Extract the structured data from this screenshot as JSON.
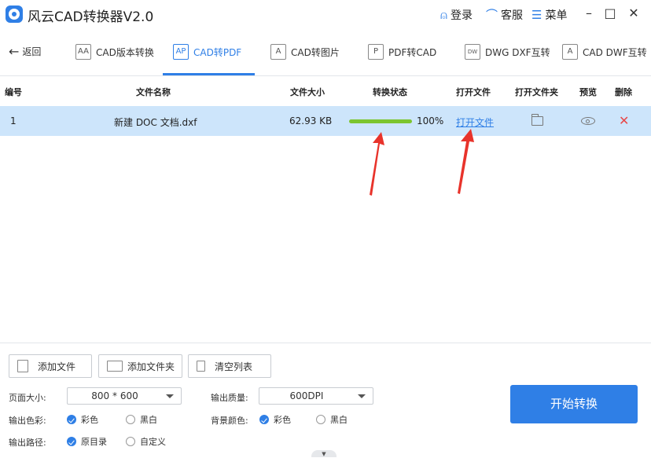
{
  "titlebar": {
    "title": "风云CAD转换器V2.0",
    "login_label": "登录",
    "service_label": "客服",
    "menu_label": "菜单",
    "minimize_glyph": "–",
    "maximize_glyph": "□",
    "close_glyph": "✕"
  },
  "nav": {
    "back_label": "返回",
    "tabs": [
      {
        "label": "CAD版本转换",
        "icon": "A͟A"
      },
      {
        "label": "CAD转PDF",
        "icon": "A͟P"
      },
      {
        "label": "CAD转图片",
        "icon": "A͟"
      },
      {
        "label": "PDF转CAD",
        "icon": "P͟"
      },
      {
        "label": "DWG DXF互转",
        "icon": "DW"
      },
      {
        "label": "CAD DWF互转",
        "icon": "A͟"
      }
    ],
    "active_tab": "CAD转PDF"
  },
  "table": {
    "headers": {
      "index": "编号",
      "name": "文件名称",
      "size": "文件大小",
      "status": "转换状态",
      "open_file": "打开文件",
      "open_folder": "打开文件夹",
      "preview": "预览",
      "delete": "删除"
    },
    "rows": [
      {
        "index": "1",
        "name": "新建 DOC 文档.dxf",
        "size": "62.93 KB",
        "progress": 100,
        "progress_label": "100%",
        "open_link": "打开文件"
      }
    ]
  },
  "actions": {
    "add_file": "添加文件",
    "add_folder": "添加文件夹",
    "clear_list": "清空列表"
  },
  "settings": {
    "page_size_label": "页面大小:",
    "page_size_value": "800 * 600",
    "output_quality_label": "输出质量:",
    "output_quality_value": "600DPI",
    "output_color_label": "输出色彩:",
    "output_color_options": [
      "彩色",
      "黑白"
    ],
    "output_color_selected": "彩色",
    "bg_color_label": "背景颜色:",
    "bg_color_options": [
      "彩色",
      "黑白"
    ],
    "bg_color_selected": "彩色",
    "output_path_label": "输出路径:",
    "output_path_options": [
      "原目录",
      "自定义"
    ],
    "output_path_selected": "原目录"
  },
  "start_button": "开始转换",
  "colors": {
    "accent": "#2f7fe6",
    "row_highlight": "#cde5fb",
    "progress": "#7cc52f",
    "delete": "#e84848",
    "annotation_arrow": "#e8332b"
  }
}
